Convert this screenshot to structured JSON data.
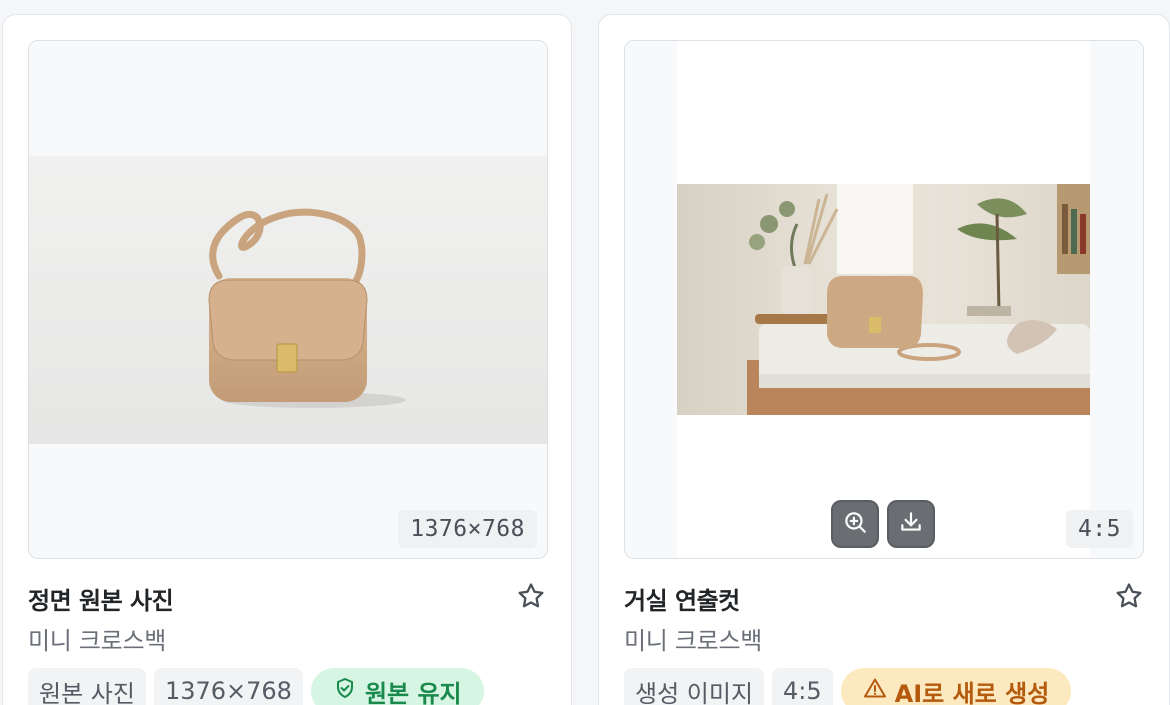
{
  "cards": [
    {
      "title": "정면 원본 사진",
      "subtitle": "미니 크로스백",
      "image_badge": "1376×768",
      "tags": [
        "원본 사진",
        "1376×768"
      ],
      "status": {
        "label": "원본 유지",
        "icon": "shield-check-icon",
        "color": "#1a8a4c"
      },
      "favorite_icon": "star-outline-icon"
    },
    {
      "title": "거실 연출컷",
      "subtitle": "미니 크로스백",
      "image_badge": "4:5",
      "tags": [
        "생성 이미지",
        "4:5"
      ],
      "status": {
        "label": "AI로 새로 생성",
        "icon": "warning-triangle-icon",
        "color": "#b45a0c"
      },
      "favorite_icon": "star-outline-icon",
      "image_actions": [
        "zoom-in-icon",
        "download-icon"
      ]
    }
  ],
  "colors": {
    "bag": "#cdaa85",
    "green_badge": "#d7f5e3",
    "amber_badge": "#fde9bf"
  }
}
